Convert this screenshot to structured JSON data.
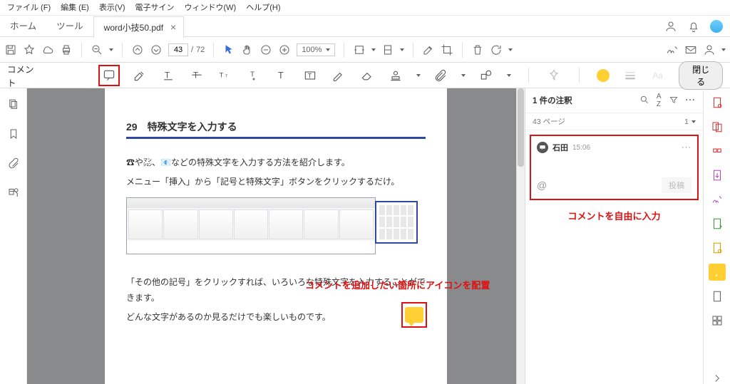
{
  "menu": [
    "ファイル (F)",
    "編集 (E)",
    "表示(V)",
    "電子サイン",
    "ウィンドウ(W)",
    "ヘルプ(H)"
  ],
  "tabs": {
    "home": "ホーム",
    "tools": "ツール",
    "file": "word小技50.pdf"
  },
  "toolbar1": {
    "page_current": "43",
    "page_total": "72",
    "zoom": "100%"
  },
  "comment_bar_label": "コメント",
  "close_btn": "閉じる",
  "doc": {
    "heading": "29　特殊文字を入力する",
    "p1": "☎や㍇、📧などの特殊文字を入力する方法を紹介します。",
    "p2": "メニュー「挿入」から「記号と特殊文字」ボタンをクリックするだけ。",
    "p3": "「その他の記号」をクリックすれば、いろいろな特殊文字を入力することができます。",
    "p4": "どんな文字があるのか見るだけでも楽しいものです。"
  },
  "annotation1": "コメントを追加したい箇所にアイコンを配置",
  "annotation2": "コメントを自由に入力",
  "panel": {
    "count": "1 件の注釈",
    "page_label": "43 ページ",
    "page_idx": "1",
    "author": "石田",
    "time": "15:06",
    "post": "投稿"
  }
}
